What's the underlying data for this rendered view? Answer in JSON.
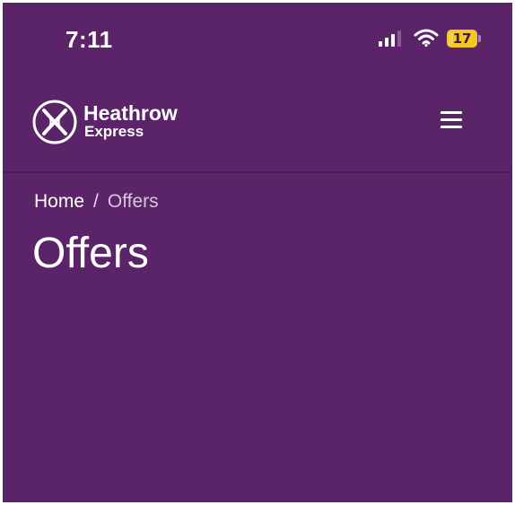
{
  "status_bar": {
    "time": "7:11",
    "battery_level": "17",
    "battery_percent": 17,
    "signal_icon": "cellular-signal-icon",
    "wifi_icon": "wifi-icon",
    "battery_color": "#f3c623"
  },
  "header": {
    "logo_name": "Heathrow",
    "logo_sub": "Express",
    "logo_icon": "heathrow-express-logo-icon",
    "menu_icon": "hamburger-menu-icon"
  },
  "breadcrumb": {
    "home": "Home",
    "separator": "/",
    "current": "Offers"
  },
  "page": {
    "title": "Offers"
  },
  "colors": {
    "background": "#5b2368",
    "text": "#ffffff",
    "divider": "#4a1c55"
  }
}
